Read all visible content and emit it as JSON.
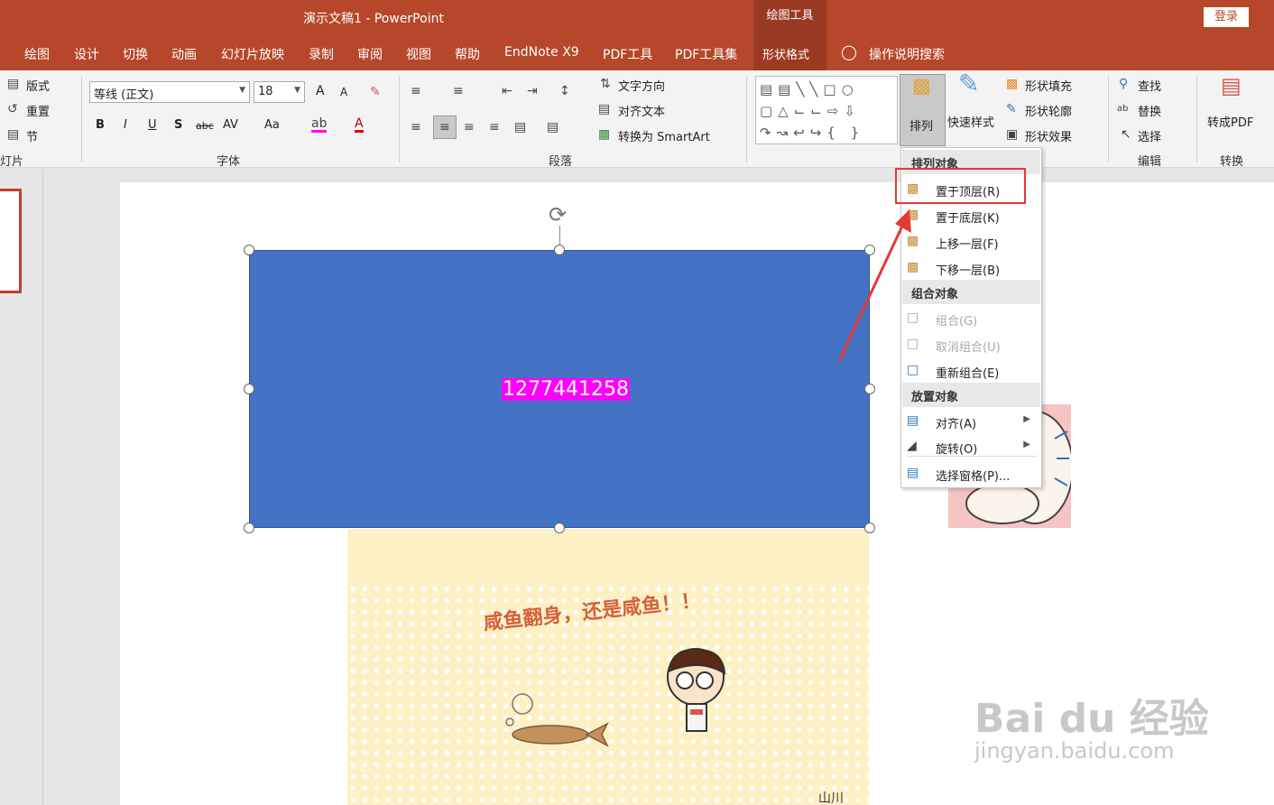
{
  "titlebar": {
    "doc_title": "演示文稿1  -  PowerPoint",
    "context_tab": "绘图工具",
    "login": "登录"
  },
  "tabs": [
    "绘图",
    "设计",
    "切换",
    "动画",
    "幻灯片放映",
    "录制",
    "审阅",
    "视图",
    "帮助",
    "EndNote X9",
    "PDF工具",
    "PDF工具集"
  ],
  "active_tab": "形状格式",
  "tell_me": "操作说明搜索",
  "ribbon": {
    "slides": {
      "layout": "版式",
      "reset": "重置",
      "section": "节",
      "label": "灯片"
    },
    "font": {
      "name": "等线 (正文)",
      "size": "18",
      "label": "字体",
      "bold": "B",
      "italic": "I",
      "underline": "U",
      "shadow": "S",
      "strike": "abc",
      "spacing": "AV",
      "case": "Aa",
      "grow": "A",
      "shrink": "A"
    },
    "paragraph": {
      "text_direction": "文字方向",
      "align_text": "对齐文本",
      "smartart": "转换为 SmartArt",
      "label": "段落"
    },
    "drawing": {
      "arrange": "排列",
      "quick_styles": "快速样式",
      "fill": "形状填充",
      "outline": "形状轮廓",
      "effects": "形状效果"
    },
    "editing": {
      "find": "查找",
      "replace": "替换",
      "select": "选择",
      "label": "编辑"
    },
    "convert": {
      "to_pdf": "转成PDF",
      "label": "转换"
    }
  },
  "slide": {
    "shape_text": "1277441258",
    "picture_caption": "咸鱼翻身，还是咸鱼！！",
    "picture_corner": "山川"
  },
  "menu": {
    "sections": [
      {
        "header": "排列对象",
        "items": [
          {
            "label": "置于顶层(R)",
            "icon": "bring-front-icon",
            "enabled": true
          },
          {
            "label": "置于底层(K)",
            "icon": "send-back-icon",
            "enabled": true
          },
          {
            "label": "上移一层(F)",
            "icon": "bring-forward-icon",
            "enabled": true
          },
          {
            "label": "下移一层(B)",
            "icon": "send-backward-icon",
            "enabled": true
          }
        ]
      },
      {
        "header": "组合对象",
        "items": [
          {
            "label": "组合(G)",
            "icon": "group-icon",
            "enabled": false
          },
          {
            "label": "取消组合(U)",
            "icon": "ungroup-icon",
            "enabled": false
          },
          {
            "label": "重新组合(E)",
            "icon": "regroup-icon",
            "enabled": true
          }
        ]
      },
      {
        "header": "放置对象",
        "items": [
          {
            "label": "对齐(A)",
            "icon": "align-icon",
            "enabled": true,
            "submenu": true
          },
          {
            "label": "旋转(O)",
            "icon": "rotate-icon",
            "enabled": true,
            "submenu": true
          }
        ]
      }
    ],
    "selection_pane": "选择窗格(P)..."
  },
  "watermark": {
    "brand": "Bai du 经验",
    "url": "jingyan.baidu.com"
  },
  "colors": {
    "accent": "#b7472a",
    "shape_fill": "#4472c4",
    "text_highlight": "#ff00ff",
    "annotation": "#e53935"
  }
}
